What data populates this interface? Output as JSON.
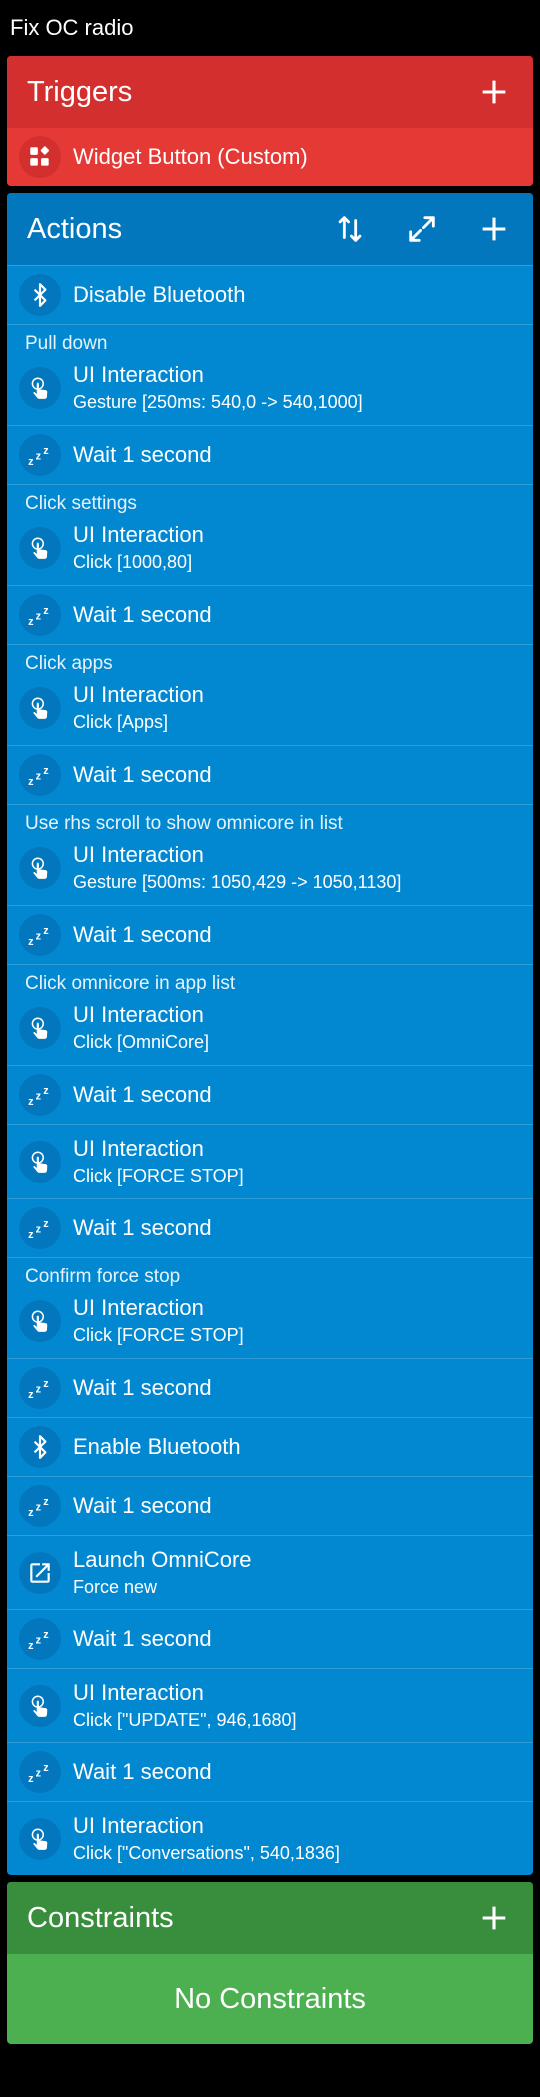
{
  "app": {
    "title": "Fix OC radio"
  },
  "triggers": {
    "title": "Triggers",
    "items": [
      {
        "label": "Widget Button (Custom)",
        "icon": "widget-icon"
      }
    ]
  },
  "actions": {
    "title": "Actions",
    "items": [
      {
        "type": "bluetooth",
        "main": "Disable Bluetooth"
      },
      {
        "comment": "Pull down"
      },
      {
        "type": "ui",
        "main": "UI Interaction",
        "sub": "Gesture [250ms: 540,0 -> 540,1000]"
      },
      {
        "type": "wait",
        "main": "Wait 1 second"
      },
      {
        "comment": "Click settings"
      },
      {
        "type": "ui",
        "main": "UI Interaction",
        "sub": "Click [1000,80]"
      },
      {
        "type": "wait",
        "main": "Wait 1 second"
      },
      {
        "comment": "Click apps"
      },
      {
        "type": "ui",
        "main": "UI Interaction",
        "sub": "Click [Apps]"
      },
      {
        "type": "wait",
        "main": "Wait 1 second"
      },
      {
        "comment": "Use rhs scroll to show omnicore in list"
      },
      {
        "type": "ui",
        "main": "UI Interaction",
        "sub": "Gesture [500ms: 1050,429 -> 1050,1130]"
      },
      {
        "type": "wait",
        "main": "Wait 1 second"
      },
      {
        "comment": "Click omnicore in app list"
      },
      {
        "type": "ui",
        "main": "UI Interaction",
        "sub": "Click [OmniCore]"
      },
      {
        "type": "wait",
        "main": "Wait 1 second"
      },
      {
        "type": "ui",
        "main": "UI Interaction",
        "sub": "Click [FORCE STOP]"
      },
      {
        "type": "wait",
        "main": "Wait 1 second"
      },
      {
        "comment": "Confirm force stop"
      },
      {
        "type": "ui",
        "main": "UI Interaction",
        "sub": "Click [FORCE STOP]"
      },
      {
        "type": "wait",
        "main": "Wait 1 second"
      },
      {
        "type": "bluetooth",
        "main": "Enable Bluetooth"
      },
      {
        "type": "wait",
        "main": "Wait 1 second"
      },
      {
        "type": "launch",
        "main": "Launch OmniCore",
        "sub": "Force new"
      },
      {
        "type": "wait",
        "main": "Wait 1 second"
      },
      {
        "type": "ui",
        "main": "UI Interaction",
        "sub": "Click [\"UPDATE\", 946,1680]"
      },
      {
        "type": "wait",
        "main": "Wait 1 second"
      },
      {
        "type": "ui",
        "main": "UI Interaction",
        "sub": "Click [\"Conversations\", 540,1836]"
      }
    ]
  },
  "constraints": {
    "title": "Constraints",
    "empty_text": "No Constraints"
  },
  "colors": {
    "triggers": "#E53935",
    "actions": "#0288D1",
    "constraints": "#4CAF50"
  }
}
